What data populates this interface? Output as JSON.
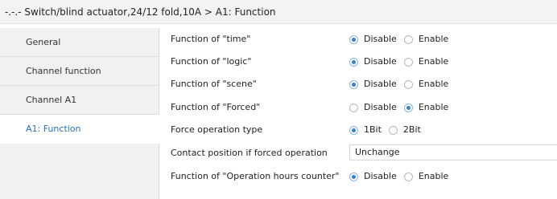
{
  "header": {
    "title": "-.-.- Switch/blind actuator,24/12 fold,10A > A1: Function"
  },
  "sidebar": {
    "items": [
      {
        "label": "General"
      },
      {
        "label": "Channel function"
      },
      {
        "label": "Channel A1"
      },
      {
        "label": "A1: Function"
      }
    ],
    "active": "A1: Function",
    "active_color": "#2a6fb5"
  },
  "params": [
    {
      "label": "Function of \"time\"",
      "options": [
        "Disable",
        "Enable"
      ],
      "selected": "Disable"
    },
    {
      "label": "Function of \"logic\"",
      "options": [
        "Disable",
        "Enable"
      ],
      "selected": "Disable"
    },
    {
      "label": "Function of \"scene\"",
      "options": [
        "Disable",
        "Enable"
      ],
      "selected": "Disable"
    },
    {
      "label": "Function of \"Forced\"",
      "options": [
        "Disable",
        "Enable"
      ],
      "selected": "Enable"
    },
    {
      "label": "Force operation type",
      "options": [
        "1Bit",
        "2Bit"
      ],
      "selected": "1Bit"
    },
    {
      "label": "Contact position if forced operation",
      "select_value": "Unchange"
    },
    {
      "label": "Function of \"Operation hours counter\"",
      "options": [
        "Disable",
        "Enable"
      ],
      "selected": "Disable"
    }
  ]
}
